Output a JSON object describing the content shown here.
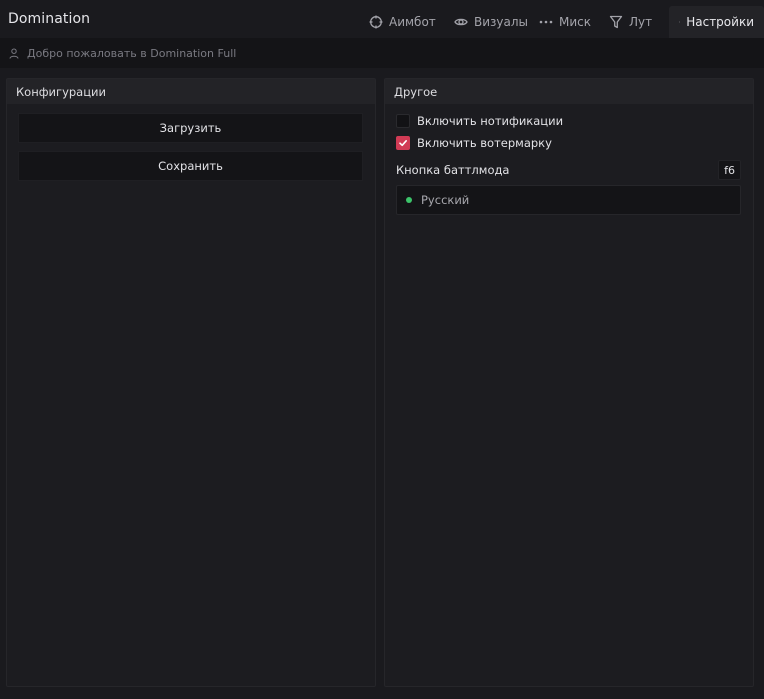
{
  "app": {
    "title": "Domination"
  },
  "tabs": [
    {
      "label": "Аимбот",
      "icon": "crosshair-icon",
      "active": false
    },
    {
      "label": "Визуалы",
      "icon": "eye-icon",
      "active": false
    },
    {
      "label": "Миск",
      "icon": "more-dots-icon",
      "active": false
    },
    {
      "label": "Лут",
      "icon": "filter-icon",
      "active": false
    },
    {
      "label": "Настройки",
      "icon": "gear-icon",
      "active": true
    }
  ],
  "welcome": {
    "text": "Добро пожаловать в Domination Full",
    "icon": "user-icon"
  },
  "configs": {
    "title": "Конфигурации",
    "load_label": "Загрузить",
    "save_label": "Сохранить"
  },
  "other": {
    "title": "Другое",
    "notifications": {
      "label": "Включить нотификации",
      "checked": false
    },
    "watermark": {
      "label": "Включить вотермарку",
      "checked": true
    },
    "battlemode": {
      "label": "Кнопка баттлмода",
      "key": "f6"
    },
    "language": {
      "value": "Русский",
      "status_color": "#3cc46a"
    }
  },
  "colors": {
    "accent": "#d13b55",
    "background": "#1a1a1e",
    "panel_header": "#232327"
  }
}
